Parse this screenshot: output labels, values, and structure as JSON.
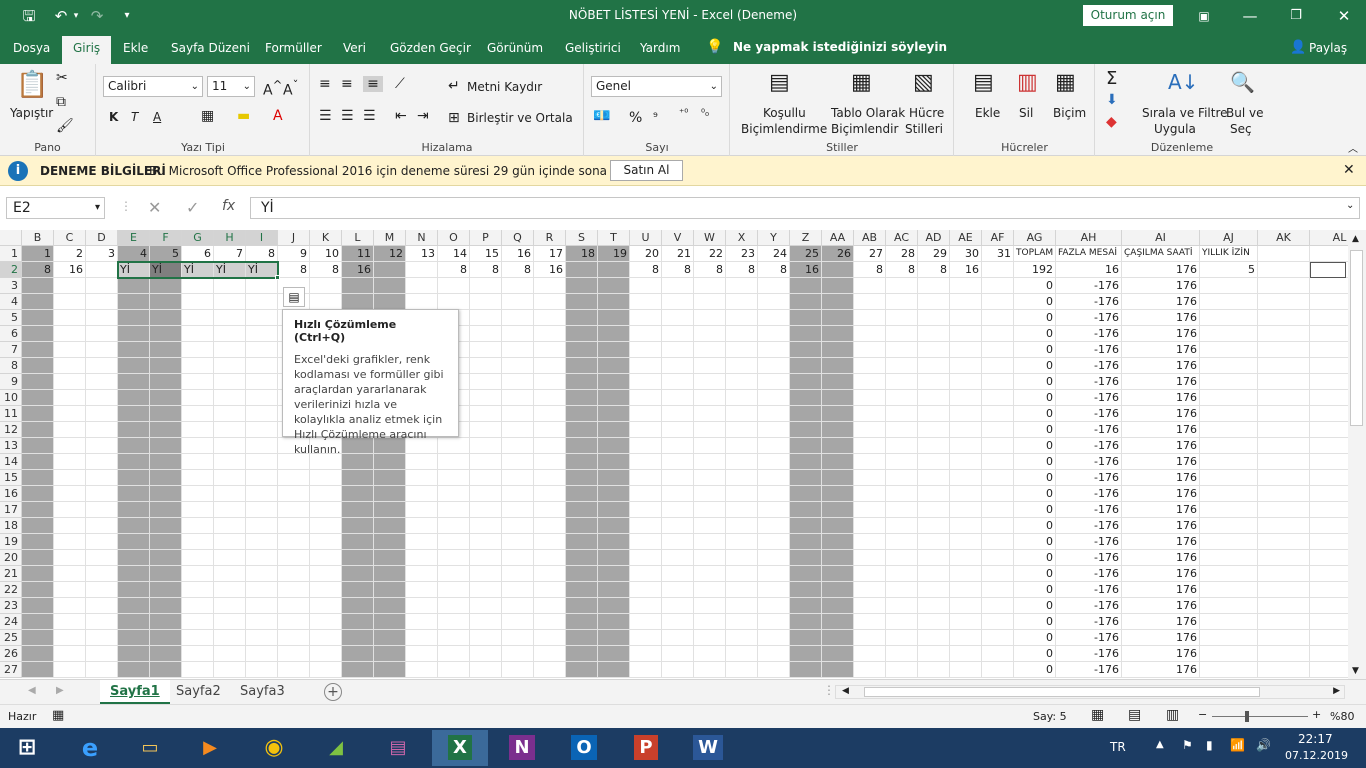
{
  "titlebar": {
    "save_icon": "save-icon",
    "undo_icon": "undo-icon",
    "redo_icon": "redo-icon",
    "customize_icon": "customize-icon",
    "title": "NÖBET LİSTESİ YENİ  -  Excel (Deneme)",
    "signin": "Oturum açın",
    "ribbon_display_icon": "ribbon-display-icon",
    "minimize_icon": "minimize-icon",
    "restore_icon": "restore-icon",
    "close_icon": "close-icon"
  },
  "tabs": [
    "Dosya",
    "Giriş",
    "Ekle",
    "Sayfa Düzeni",
    "Formüller",
    "Veri",
    "Gözden Geçir",
    "Görünüm",
    "Geliştirici",
    "Yardım"
  ],
  "tell_me": "Ne yapmak istediğinizi söyleyin",
  "share": "Paylaş",
  "ribbon": {
    "clipboard": {
      "label": "Pano",
      "paste": "Yapıştır"
    },
    "font": {
      "label": "Yazı Tipi",
      "name": "Calibri",
      "size": "11",
      "bold": "K",
      "italic": "T",
      "underline": "A"
    },
    "alignment": {
      "label": "Hizalama",
      "wrap": "Metni Kaydır",
      "merge": "Birleştir ve Ortala"
    },
    "number": {
      "label": "Sayı",
      "format": "Genel",
      "percent": "%",
      "comma": "⁹"
    },
    "styles": {
      "label": "Stiller",
      "conditional": [
        "Koşullu",
        "Biçimlendirme"
      ],
      "table": [
        "Tablo Olarak",
        "Biçimlendir"
      ],
      "cell": [
        "Hücre",
        "Stilleri"
      ]
    },
    "cells": {
      "label": "Hücreler",
      "insert": "Ekle",
      "delete": "Sil",
      "format": "Biçim"
    },
    "editing": {
      "label": "Düzenleme",
      "sort": [
        "Sırala ve Filtre",
        "Uygula"
      ],
      "find": [
        "Bul ve",
        "Seç"
      ]
    }
  },
  "message": {
    "title": "DENEME BİLGİLERİ",
    "text": "Bu Microsoft Office Professional 2016 için deneme süresi 29 gün içinde sona erecek.",
    "button": "Satın Al"
  },
  "formula_bar": {
    "name_box": "E2",
    "fx": "fx",
    "value": "Yİ"
  },
  "grid": {
    "columns": [
      "B",
      "C",
      "D",
      "E",
      "F",
      "G",
      "H",
      "I",
      "J",
      "K",
      "L",
      "M",
      "N",
      "O",
      "P",
      "Q",
      "R",
      "S",
      "T",
      "U",
      "V",
      "W",
      "X",
      "Y",
      "Z",
      "AA",
      "AB",
      "AC",
      "AD",
      "AE",
      "AF",
      "AG",
      "AH",
      "AI",
      "AJ",
      "AK",
      "AL"
    ],
    "row1": [
      "1",
      "2",
      "3",
      "4",
      "5",
      "6",
      "7",
      "8",
      "9",
      "10",
      "11",
      "12",
      "13",
      "14",
      "15",
      "16",
      "17",
      "18",
      "19",
      "20",
      "21",
      "22",
      "23",
      "24",
      "25",
      "26",
      "27",
      "28",
      "29",
      "30",
      "31",
      "TOPLAM",
      "FAZLA MESAİ",
      "ÇAŞILMA SAATİ",
      "YILLIK İZİN",
      "",
      ""
    ],
    "row2": [
      "8",
      "16",
      "",
      "Yİ",
      "Yİ",
      "Yİ",
      "Yİ",
      "Yİ",
      "8",
      "8",
      "16",
      "",
      "",
      "8",
      "8",
      "8",
      "16",
      "",
      "",
      "8",
      "8",
      "8",
      "8",
      "8",
      "16",
      "",
      "8",
      "8",
      "8",
      "16",
      "",
      "192",
      "16",
      "176",
      "5",
      "",
      ""
    ],
    "rest_ag": "0",
    "rest_ah": "-176",
    "rest_ai": "176",
    "row_numbers": [
      "1",
      "2",
      "3",
      "4",
      "5",
      "6",
      "7",
      "8",
      "9",
      "10",
      "11",
      "12",
      "13",
      "14",
      "15",
      "16",
      "17",
      "18",
      "19",
      "20",
      "21",
      "22",
      "23",
      "24",
      "25",
      "26",
      "27"
    ]
  },
  "quick_analysis": {
    "icon": "quick-analysis-icon",
    "title": "Hızlı Çözümleme (Ctrl+Q)",
    "body": "Excel'deki grafikler, renk kodlaması ve formüller gibi araçlardan yararlanarak verilerinizi hızla ve kolaylıkla analiz etmek için Hızlı Çözümleme aracını kullanın."
  },
  "sheets": [
    "Sayfa1",
    "Sayfa2",
    "Sayfa3"
  ],
  "status": {
    "ready": "Hazır",
    "count": "Say: 5",
    "zoom": "%80"
  },
  "taskbar": {
    "lang": "TR",
    "time": "22:17",
    "date": "07.12.2019"
  },
  "colors": {
    "excel_green": "#217346",
    "gray_column": "#a6a6a6",
    "selected_gray": "#d0d0d0"
  }
}
